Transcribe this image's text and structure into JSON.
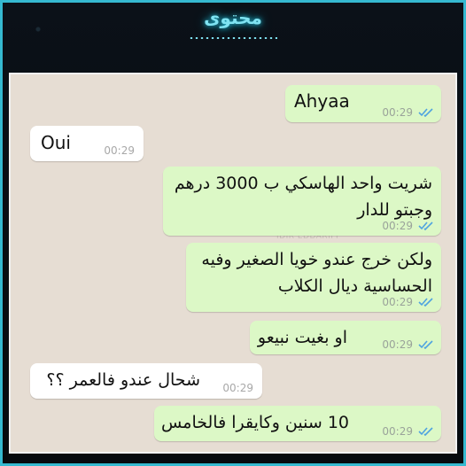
{
  "header": {
    "brand": "محتوى"
  },
  "chat": {
    "watermark": "IDIR EDDARIFI",
    "messages": [
      {
        "dir": "out",
        "text": "Ahyaa",
        "time": "00:29",
        "read": true
      },
      {
        "dir": "in",
        "text": "Oui",
        "time": "00:29"
      },
      {
        "dir": "out",
        "text": "شريت واحد الهاسكي ب 3000 درهم وجبتو للدار",
        "time": "00:29",
        "read": true
      },
      {
        "dir": "out",
        "text": "ولكن خرج عندو خويا الصغير وفيه الحساسية ديال الكلاب",
        "time": "00:29",
        "read": true
      },
      {
        "dir": "out",
        "text": "او بغيت نبيعو",
        "time": "00:29",
        "read": true
      },
      {
        "dir": "in",
        "text": "شحال عندو فالعمر ؟؟",
        "time": "00:29"
      },
      {
        "dir": "out",
        "text": "10 سنين وكايقرا فالخامس",
        "time": "00:29",
        "read": true
      }
    ]
  },
  "colors": {
    "outgoing": "#dcf8c6",
    "incoming": "#ffffff",
    "tick": "#4fa3e0",
    "frame": "#35b9d0"
  },
  "icons": {
    "read_receipt": "double-check-icon"
  }
}
